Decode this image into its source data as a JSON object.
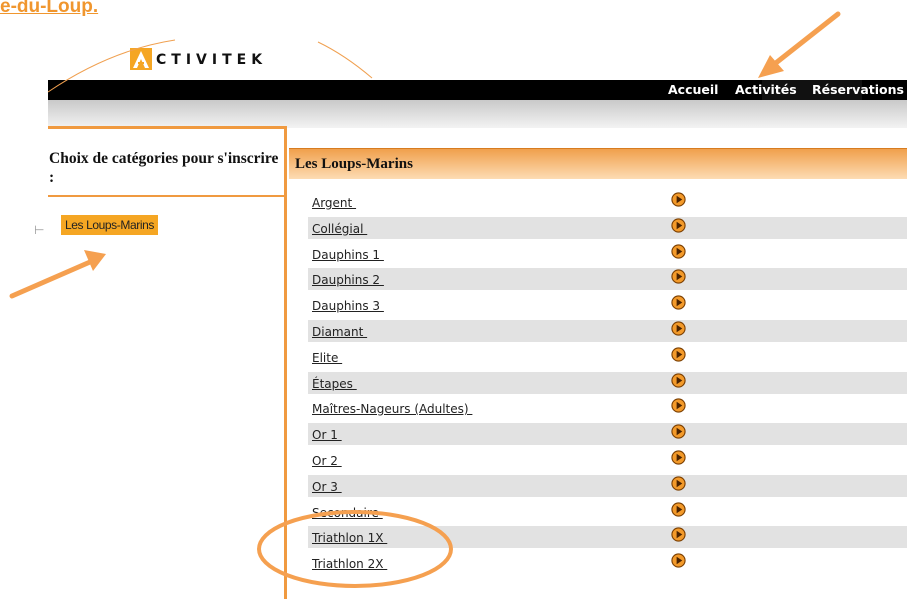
{
  "header_link": "e-du-Loup.",
  "logo": {
    "text": "CTIVITEK",
    "icon": "activitek-a-logo-icon"
  },
  "nav": {
    "accueil": "Accueil",
    "activites": "Activités",
    "reservations": "Réservations"
  },
  "sidebar": {
    "title": "Choix de catégories pour s'inscrire :",
    "items": [
      {
        "label": "Les Loups-Marins"
      }
    ]
  },
  "main": {
    "title": "Les Loups-Marins",
    "categories": [
      {
        "label": "Argent ",
        "icon": "play-circle-icon"
      },
      {
        "label": "Collégial ",
        "icon": "play-circle-icon"
      },
      {
        "label": "Dauphins 1 ",
        "icon": "play-circle-icon"
      },
      {
        "label": "Dauphins 2 ",
        "icon": "play-circle-icon"
      },
      {
        "label": "Dauphins 3 ",
        "icon": "play-circle-icon"
      },
      {
        "label": "Diamant ",
        "icon": "play-circle-icon"
      },
      {
        "label": "Elite ",
        "icon": "play-circle-icon"
      },
      {
        "label": "Étapes ",
        "icon": "play-circle-icon"
      },
      {
        "label": "Maîtres-Nageurs (Adultes) ",
        "icon": "play-circle-icon"
      },
      {
        "label": "Or 1 ",
        "icon": "play-circle-icon"
      },
      {
        "label": "Or 2 ",
        "icon": "play-circle-icon"
      },
      {
        "label": "Or 3 ",
        "icon": "play-circle-icon"
      },
      {
        "label": "Secondaire ",
        "icon": "play-circle-icon"
      },
      {
        "label": "Triathlon 1X ",
        "icon": "play-circle-icon"
      },
      {
        "label": "Triathlon 2X ",
        "icon": "play-circle-icon"
      }
    ]
  },
  "colors": {
    "accent": "#f0962e",
    "nav_bg": "#000000",
    "row_alt": "#e2e2e2",
    "annotation": "#f5a050"
  }
}
